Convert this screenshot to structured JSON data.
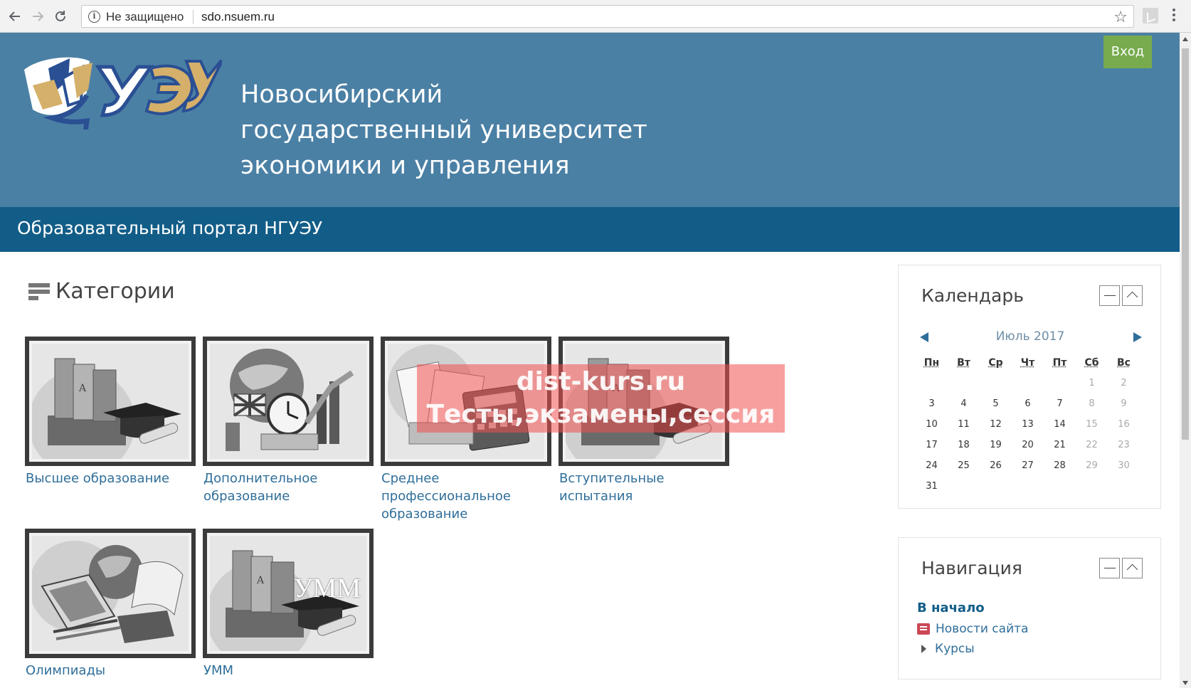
{
  "browser": {
    "insecure_label": "Не защищено",
    "url": "sdo.nsuem.ru",
    "icons": [
      "back-arrow-icon",
      "forward-arrow-icon",
      "reload-icon",
      "info-icon",
      "star-icon",
      "extension-icon",
      "menu-dots-icon"
    ]
  },
  "header": {
    "title": "Новосибирский государственный университет экономики и управления",
    "login_label": "Вход",
    "subtitle": "Образовательный портал НГУЭУ",
    "colors": {
      "header_bg": "#4b80a5",
      "subbar_bg": "#125d88",
      "login_bg": "#77ab4e"
    }
  },
  "categories": {
    "heading": "Категории",
    "items": [
      {
        "label": "Высшее образование",
        "image": "folders-graduation-cap"
      },
      {
        "label": "Дополнительное образование",
        "image": "globe-clock-money"
      },
      {
        "label": "Среднее профессиональное образование",
        "image": "calculator-documents"
      },
      {
        "label": "Вступительные испытания",
        "image": "folders-graduation-cap"
      },
      {
        "label": "Олимпиады",
        "image": "globe-laptop-books"
      },
      {
        "label": "УММ",
        "image": "folders-graduation-cap",
        "overlay_text": "УММ"
      }
    ]
  },
  "watermark": {
    "line1": "dist-kurs.ru",
    "line2": "Тесты,экзамены,сессия"
  },
  "calendar": {
    "title": "Календарь",
    "month": "Июль 2017",
    "weekdays": [
      "Пн",
      "Вт",
      "Ср",
      "Чт",
      "Пт",
      "Сб",
      "Вс"
    ],
    "weeks": [
      [
        "",
        "",
        "",
        "",
        "",
        "1",
        "2"
      ],
      [
        "3",
        "4",
        "5",
        "6",
        "7",
        "8",
        "9"
      ],
      [
        "10",
        "11",
        "12",
        "13",
        "14",
        "15",
        "16"
      ],
      [
        "17",
        "18",
        "19",
        "20",
        "21",
        "22",
        "23"
      ],
      [
        "24",
        "25",
        "26",
        "27",
        "28",
        "29",
        "30"
      ],
      [
        "31",
        "",
        "",
        "",
        "",
        "",
        ""
      ]
    ]
  },
  "navigation": {
    "title": "Навигация",
    "home": "В начало",
    "news": "Новости сайта",
    "courses": "Курсы"
  }
}
